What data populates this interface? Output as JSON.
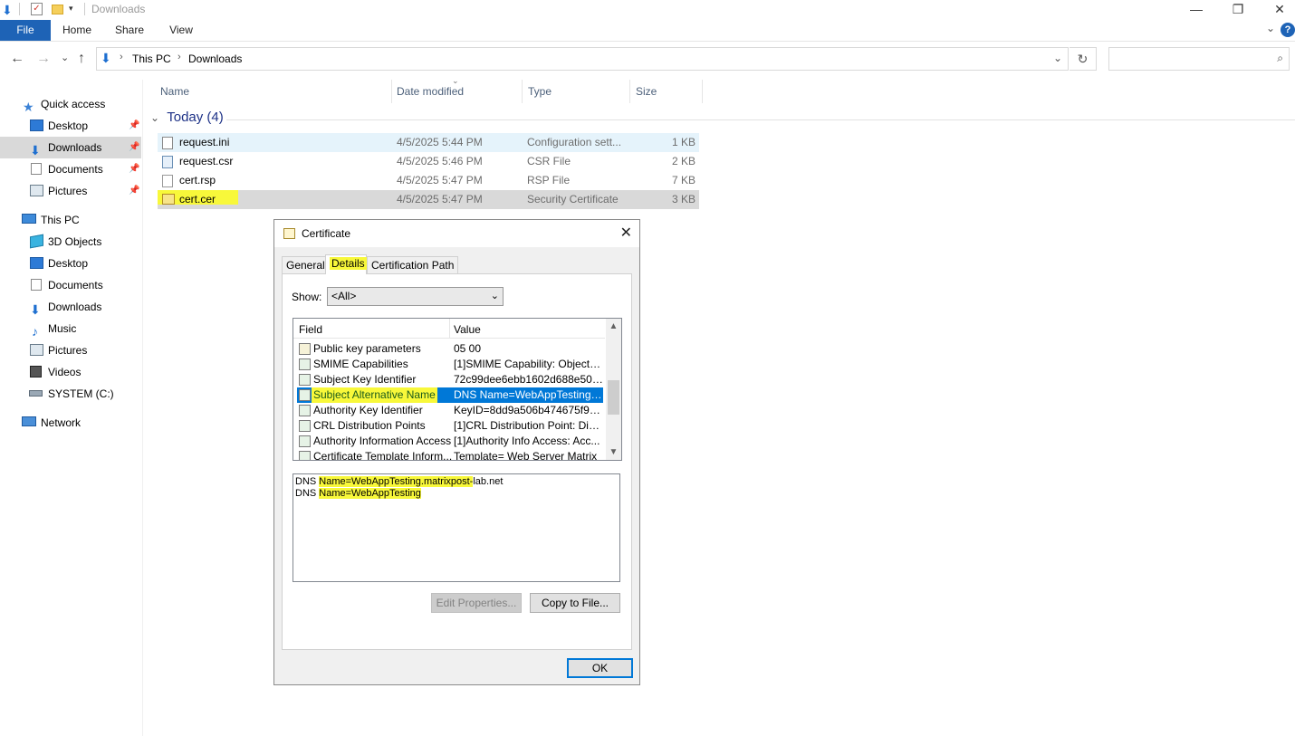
{
  "window": {
    "title": "Downloads",
    "controls": {
      "minimize": "—",
      "maximize": "❐",
      "close": "✕"
    }
  },
  "ribbon": {
    "tabs": [
      "File",
      "Home",
      "Share",
      "View"
    ],
    "help": "?",
    "collapse": "⌄"
  },
  "address": {
    "back": "←",
    "forward": "→",
    "recent": "⌄",
    "up": "↑",
    "segments": [
      "This PC",
      "Downloads"
    ],
    "search_placeholder": ""
  },
  "sidebar": {
    "items": [
      {
        "label": "Quick access",
        "icon": "star-icon",
        "indent": 1
      },
      {
        "label": "Desktop",
        "icon": "desktop-icon",
        "indent": 2,
        "pinned": true
      },
      {
        "label": "Downloads",
        "icon": "download-arrow-icon",
        "indent": 2,
        "pinned": true,
        "selected": true
      },
      {
        "label": "Documents",
        "icon": "documents-icon",
        "indent": 2,
        "pinned": true
      },
      {
        "label": "Pictures",
        "icon": "pictures-icon",
        "indent": 2,
        "pinned": true
      },
      {
        "label": "This PC",
        "icon": "computer-icon",
        "indent": 1
      },
      {
        "label": "3D Objects",
        "icon": "cube-icon",
        "indent": 2
      },
      {
        "label": "Desktop",
        "icon": "desktop-icon",
        "indent": 2
      },
      {
        "label": "Documents",
        "icon": "documents-icon",
        "indent": 2
      },
      {
        "label": "Downloads",
        "icon": "download-arrow-icon",
        "indent": 2
      },
      {
        "label": "Music",
        "icon": "music-note-icon",
        "indent": 2
      },
      {
        "label": "Pictures",
        "icon": "pictures-icon",
        "indent": 2
      },
      {
        "label": "Videos",
        "icon": "film-icon",
        "indent": 2
      },
      {
        "label": "SYSTEM (C:)",
        "icon": "drive-icon",
        "indent": 2
      },
      {
        "label": "Network",
        "icon": "network-icon",
        "indent": 1
      }
    ]
  },
  "filelist": {
    "columns": {
      "name": "Name",
      "date": "Date modified",
      "type": "Type",
      "size": "Size"
    },
    "group": "Today (4)",
    "files": [
      {
        "name": "request.ini",
        "date": "4/5/2025 5:44 PM",
        "type": "Configuration sett...",
        "size": "1 KB",
        "icon": "config-file-icon"
      },
      {
        "name": "request.csr",
        "date": "4/5/2025 5:46 PM",
        "type": "CSR File",
        "size": "2 KB",
        "icon": "csr-file-icon"
      },
      {
        "name": "cert.rsp",
        "date": "4/5/2025 5:47 PM",
        "type": "RSP File",
        "size": "7 KB",
        "icon": "blank-file-icon"
      },
      {
        "name": "cert.cer",
        "date": "4/5/2025 5:47 PM",
        "type": "Security Certificate",
        "size": "3 KB",
        "icon": "certificate-file-icon"
      }
    ]
  },
  "dialog": {
    "title": "Certificate",
    "close": "✕",
    "tabs": [
      "General",
      "Details",
      "Certification Path"
    ],
    "show_label": "Show:",
    "show_value": "<All>",
    "field_header": "Field",
    "value_header": "Value",
    "fields": [
      {
        "field": "Public key parameters",
        "value": "05 00"
      },
      {
        "field": "SMIME Capabilities",
        "value": "[1]SMIME Capability: Object I..."
      },
      {
        "field": "Subject Key Identifier",
        "value": "72c99dee6ebb1602d688e509..."
      },
      {
        "field": "Subject Alternative Name",
        "value": "DNS Name=WebAppTesting.m..."
      },
      {
        "field": "Authority Key Identifier",
        "value": "KeyID=8dd9a506b474675f90..."
      },
      {
        "field": "CRL Distribution Points",
        "value": "[1]CRL Distribution Point: Distr..."
      },
      {
        "field": "Authority Information Access",
        "value": "[1]Authority Info Access: Acc..."
      },
      {
        "field": "Certificate Template Inform...",
        "value": "Template= Web Server Matrix"
      }
    ],
    "detail_lines": [
      {
        "prefix": "DNS ",
        "highlight": "Name=WebAppTesting.matrixpost-",
        "rest": "lab.net"
      },
      {
        "prefix": "DNS ",
        "highlight": "Name=WebAppTesting",
        "rest": ""
      }
    ],
    "buttons": {
      "edit": "Edit Properties...",
      "copy": "Copy to File...",
      "ok": "OK"
    },
    "colors": {
      "selection": "#0078d7",
      "highlight": "#f8f83a"
    }
  }
}
